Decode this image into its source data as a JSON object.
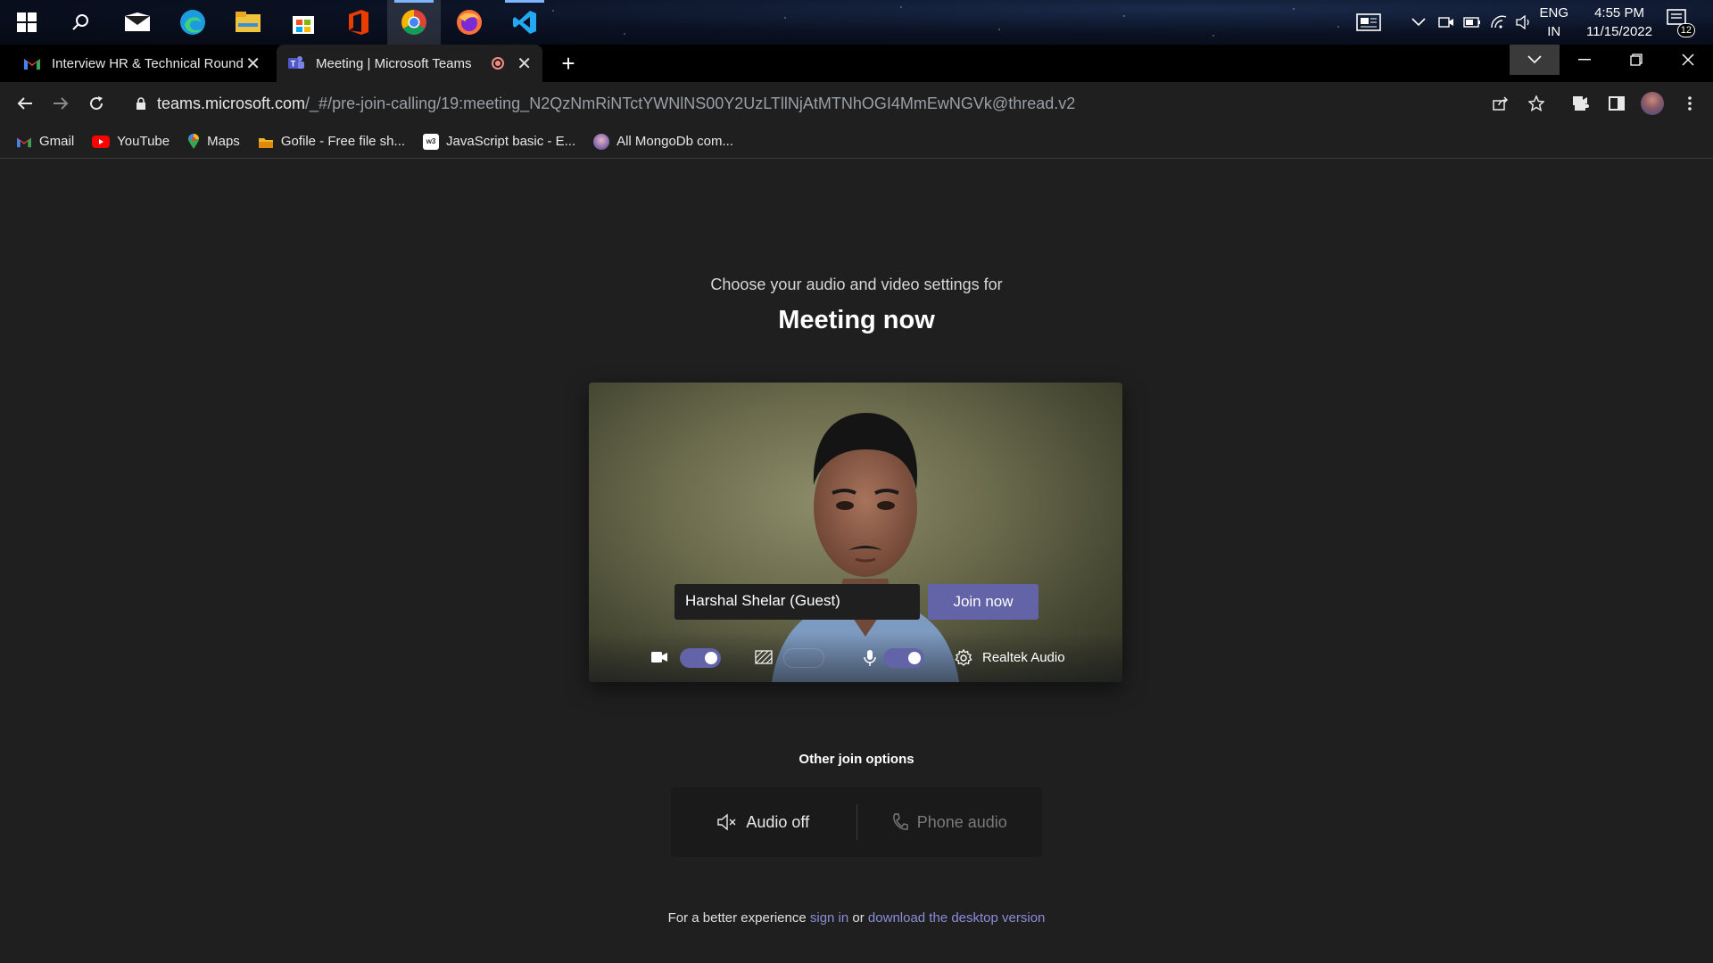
{
  "taskbar": {
    "icons": [
      "windows-start-icon",
      "search-icon",
      "mail-icon",
      "edge-icon",
      "file-explorer-icon",
      "store-icon",
      "office-icon",
      "chrome-icon",
      "firefox-icon",
      "vscode-icon"
    ],
    "lang_line1": "ENG",
    "lang_line2": "IN",
    "time": "4:55 PM",
    "date": "11/15/2022",
    "notification_count": "12"
  },
  "browser": {
    "tabs": [
      {
        "label": "Interview HR & Technical Round",
        "icon": "gmail-icon"
      },
      {
        "label": "Meeting | Microsoft Teams",
        "icon": "teams-icon",
        "recording": true
      }
    ],
    "url_host": "teams.microsoft.com",
    "url_path": "/_#/pre-join-calling/19:meeting_N2QzNmRiNTctYWNlNS00Y2UzLTllNjAtMTNhOGI4MmEwNGVk@thread.v2",
    "bookmarks": [
      {
        "label": "Gmail",
        "icon": "gmail-icon"
      },
      {
        "label": "YouTube",
        "icon": "youtube-icon"
      },
      {
        "label": "Maps",
        "icon": "maps-icon"
      },
      {
        "label": "Gofile - Free file sh...",
        "icon": "gofile-icon"
      },
      {
        "label": "JavaScript basic - E...",
        "icon": "w3schools-icon"
      },
      {
        "label": "All MongoDb com...",
        "icon": "mongodb-icon"
      }
    ]
  },
  "teams": {
    "subtitle": "Choose your audio and video settings for",
    "title": "Meeting now",
    "name_value": "Harshal Shelar (Guest)",
    "join_label": "Join now",
    "camera_on": true,
    "mic_on": true,
    "audio_device": "Realtek Audio",
    "other_options_title": "Other join options",
    "audio_off_label": "Audio off",
    "phone_audio_label": "Phone audio",
    "footer_prefix": "For a better experience",
    "sign_in_label": "sign in",
    "or_label": "or",
    "download_label": "download the desktop version",
    "accent": "#6264a7"
  }
}
